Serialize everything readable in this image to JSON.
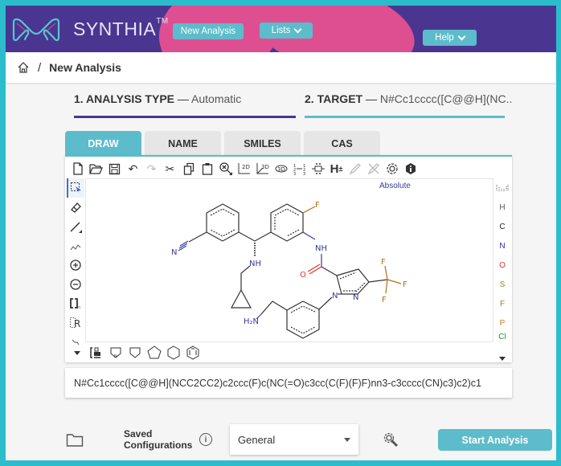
{
  "header": {
    "brand": "SYNTHIA",
    "trademark": "TM",
    "nav": [
      {
        "label": "New Analysis",
        "has_dropdown": false
      },
      {
        "label": "Lists",
        "has_dropdown": true
      },
      {
        "label": "Help",
        "has_dropdown": true
      }
    ]
  },
  "breadcrumb": {
    "home_icon": "home-icon",
    "separator": "/",
    "current": "New Analysis"
  },
  "steps": [
    {
      "label": "1. ANALYSIS TYPE",
      "dash": "—",
      "value": "Automatic",
      "color": "#4a3690"
    },
    {
      "label": "2. TARGET",
      "dash": "—",
      "value": "N#Cc1cccc([C@@H](NC..",
      "color": "#5dbccb"
    }
  ],
  "tabs": [
    {
      "label": "DRAW",
      "active": true
    },
    {
      "label": "NAME",
      "active": false
    },
    {
      "label": "SMILES",
      "active": false
    },
    {
      "label": "CAS",
      "active": false
    }
  ],
  "editor": {
    "toolbar": [
      "new-document-icon",
      "open-folder-icon",
      "save-icon",
      "undo-icon",
      "redo-icon",
      "cut-icon",
      "copy-icon",
      "paste-icon",
      "zoom-icon",
      "clean-2d-icon",
      "clean-3d-icon",
      "rotate-3d-icon",
      "enumerate-icon",
      "stereo-icon",
      "hydrogen-icon",
      "draw-pen-icon",
      "erase-pen-icon",
      "settings-icon",
      "info-icon"
    ],
    "left_tools": [
      "select-icon",
      "eraser-icon",
      "bond-icon",
      "chain-icon",
      "charge-plus-icon",
      "charge-minus-icon",
      "bracket-icon",
      "rgroup-icon",
      "reaction-arrow-icon",
      "expand-icon"
    ],
    "atoms": [
      {
        "symbol": "H",
        "color": "#555555"
      },
      {
        "symbol": "C",
        "color": "#222222"
      },
      {
        "symbol": "N",
        "color": "#2b2bb0"
      },
      {
        "symbol": "O",
        "color": "#e0332d"
      },
      {
        "symbol": "S",
        "color": "#8a8a20"
      },
      {
        "symbol": "F",
        "color": "#b0701a"
      },
      {
        "symbol": "P",
        "color": "#d07a1a"
      },
      {
        "symbol": "Cl",
        "color": "#1a9a1a"
      }
    ],
    "periodic_table_icon": "periodic-table-icon",
    "stereo_label": "Absolute",
    "bottom_tools": [
      "expand-icon",
      "template-icon",
      "pyrrole-icon",
      "cyclobutane-icon",
      "cyclopentane-icon",
      "cyclohexane-icon",
      "benzene-icon"
    ],
    "molecule_labels": {
      "nitrile_n": "N",
      "amine_nh": "NH",
      "fluoro": "F",
      "amide_nh": "NH",
      "carbonyl_o": "O",
      "cf3_f1": "F",
      "cf3_f2": "F",
      "cf3_f3": "F",
      "pyrazole_n1": "N",
      "pyrazole_n2": "N",
      "aminomethyl": "H₂N"
    }
  },
  "smiles": "N#Cc1cccc([C@@H](NCC2CC2)c2ccc(F)c(NC(=O)c3cc(C(F)(F)F)nn3-c3cccc(CN)c3)c2)c1",
  "footer": {
    "saved_configurations_line1": "Saved",
    "saved_configurations_line2": "Configurations",
    "info": "i",
    "config_selected": "General",
    "start_button": "Start Analysis"
  }
}
